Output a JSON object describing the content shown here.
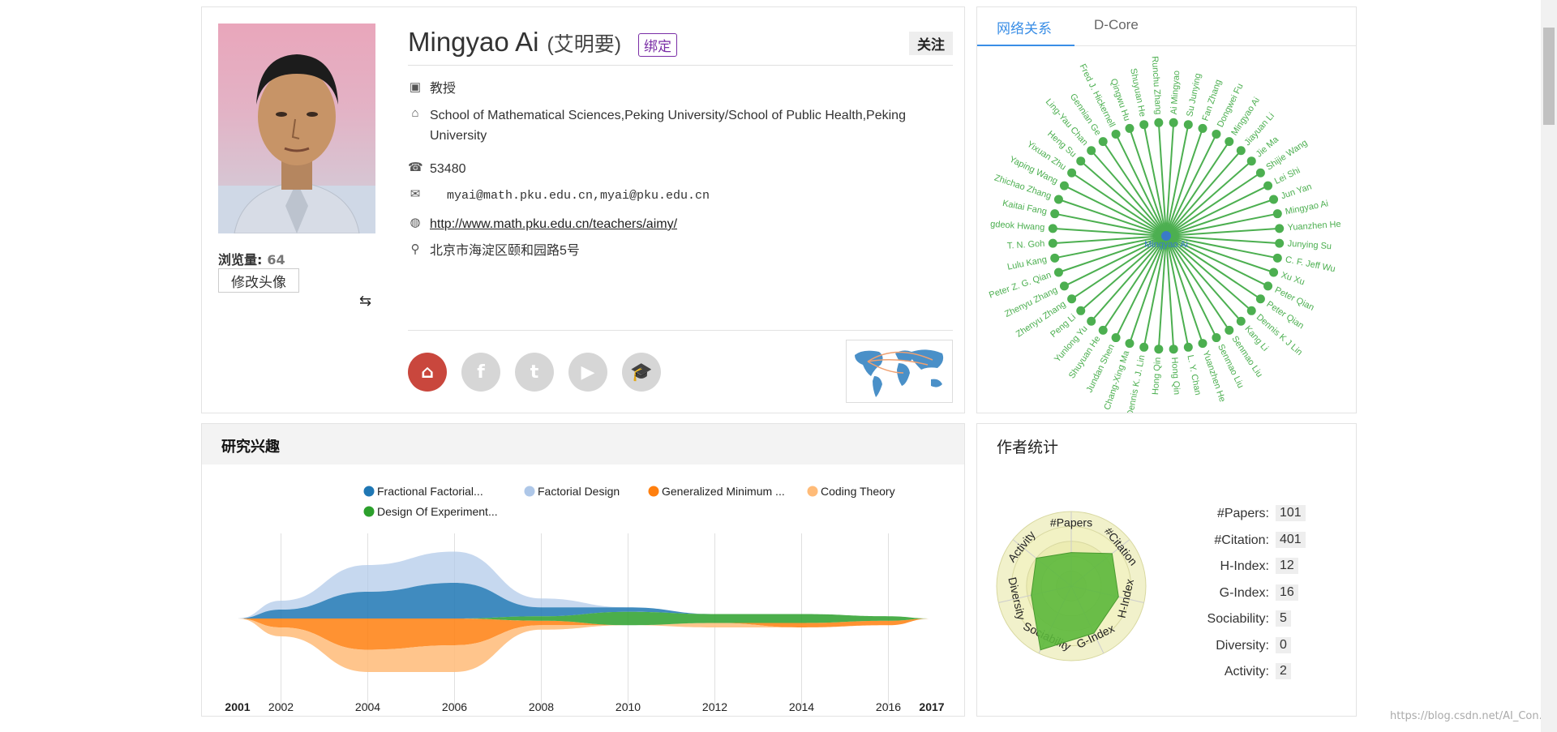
{
  "profile": {
    "name": "Mingyao Ai",
    "name_cn": "(艾明要)",
    "bind_label": "绑定",
    "follow_label": "关注",
    "views_label": "浏览量:",
    "views_value": "64",
    "change_avatar_label": "修改头像",
    "title": "教授",
    "affiliation": "School of Mathematical Sciences,Peking University/School of Public Health,Peking University",
    "phone": "53480",
    "email": "myai@math.pku.edu.cn,myai@pku.edu.cn",
    "homepage": "http://www.math.pku.edu.cn/teachers/aimy/",
    "address": "北京市海淀区颐和园路5号",
    "social": [
      {
        "icon": "home-icon",
        "glyph": "⌂",
        "color": "#c9473d"
      },
      {
        "icon": "facebook-icon",
        "glyph": "f",
        "color": "#d6d6d6"
      },
      {
        "icon": "twitter-icon",
        "glyph": "t",
        "color": "#d6d6d6"
      },
      {
        "icon": "youtube-icon",
        "glyph": "▶",
        "color": "#d6d6d6"
      },
      {
        "icon": "scholar-icon",
        "glyph": "🎓",
        "color": "#d6d6d6"
      }
    ]
  },
  "network": {
    "tabs": [
      "网络关系",
      "D-Core"
    ],
    "center": "Mingyao Ai",
    "color": "#4caf50",
    "nodes": [
      "Ai Mingyao",
      "Su Junying",
      "Fan Zhang",
      "Dongwei Fu",
      "Mingyao Ai",
      "Jiayuan Li",
      "Jie Ma",
      "Shijie Wang",
      "Lei Shi",
      "Jun Yan",
      "Mingyao Ai",
      "Yuanzhen He",
      "Junying Su",
      "C. F. Jeff Wu",
      "Xu Xu",
      "Peter Qian",
      "Peter Qian",
      "Dennis K J Lin",
      "Kang Li",
      "Senmao Liu",
      "Senmao Liu",
      "Yuanzhen He",
      "L. Y. Chan",
      "Hong Qin",
      "Hong Qin",
      "Dennis K. J. Lin",
      "Chang-Xing Ma",
      "Jundan Shen",
      "Shuyuan He",
      "Yunlong Yu",
      "Peng Li",
      "Zhenyu Zhang",
      "Zhenyu Zhang",
      "Peter Z. G. Qian",
      "Lulu Kang",
      "T. N. Goh",
      "gdeok Hwang",
      "Kaitai Fang",
      "Zhichao Zhang",
      "Yaping Wang",
      "Yixuan Zhu",
      "Heng Su",
      "Ling-Yau Chan",
      "Gennian Ge",
      "Fred J. Hickernell",
      "Qingwu Hu",
      "Shuyuan He",
      "Runchu Zhang"
    ]
  },
  "interests": {
    "title": "研究兴趣",
    "legend": [
      {
        "name": "Fractional Factorial...",
        "color": "#1f77b4"
      },
      {
        "name": "Factorial Design",
        "color": "#aec7e8"
      },
      {
        "name": "Generalized Minimum ...",
        "color": "#ff7f0e"
      },
      {
        "name": "Coding Theory",
        "color": "#ffbb78"
      },
      {
        "name": "Design Of Experiment...",
        "color": "#2ca02c"
      }
    ],
    "x_ticks": [
      "2001",
      "2002",
      "2004",
      "2006",
      "2008",
      "2010",
      "2012",
      "2014",
      "2016",
      "2017"
    ]
  },
  "chart_data": {
    "type": "area",
    "title": "",
    "x": [
      2001,
      2002,
      2004,
      2006,
      2008,
      2010,
      2012,
      2014,
      2016,
      2017
    ],
    "series": [
      {
        "name": "Fractional Factorial...",
        "values": [
          0,
          2,
          6,
          8,
          2,
          1,
          0,
          0,
          0,
          0
        ]
      },
      {
        "name": "Factorial Design",
        "values": [
          0,
          2,
          6,
          7,
          2,
          0,
          0,
          0,
          0,
          0
        ]
      },
      {
        "name": "Generalized Minimum ...",
        "values": [
          0,
          2,
          7,
          6,
          1,
          0,
          0,
          1,
          1,
          0
        ]
      },
      {
        "name": "Coding Theory",
        "values": [
          0,
          2,
          5,
          6,
          1,
          0,
          1,
          0,
          0,
          0
        ]
      },
      {
        "name": "Design Of Experiment...",
        "values": [
          0,
          0,
          0,
          0,
          1,
          3,
          2,
          2,
          1,
          0
        ]
      }
    ]
  },
  "stats": {
    "title": "作者统计",
    "rows": [
      {
        "label": "#Papers:",
        "value": "101"
      },
      {
        "label": "#Citation:",
        "value": "401"
      },
      {
        "label": "H-Index:",
        "value": "12"
      },
      {
        "label": "G-Index:",
        "value": "16"
      },
      {
        "label": "Sociability:",
        "value": "5"
      },
      {
        "label": "Diversity:",
        "value": "0"
      },
      {
        "label": "Activity:",
        "value": "2"
      }
    ],
    "radar_axes": [
      "#Papers",
      "#Citation",
      "H-Index",
      "G-Index",
      "Sociability",
      "Diversity",
      "Activity"
    ],
    "radar_levels": [
      0.45,
      0.7,
      0.65,
      0.7,
      0.95,
      0.55,
      0.6
    ],
    "radar_color": "#5cb83c"
  },
  "watermark": "https://blog.csdn.net/AI_Con..."
}
